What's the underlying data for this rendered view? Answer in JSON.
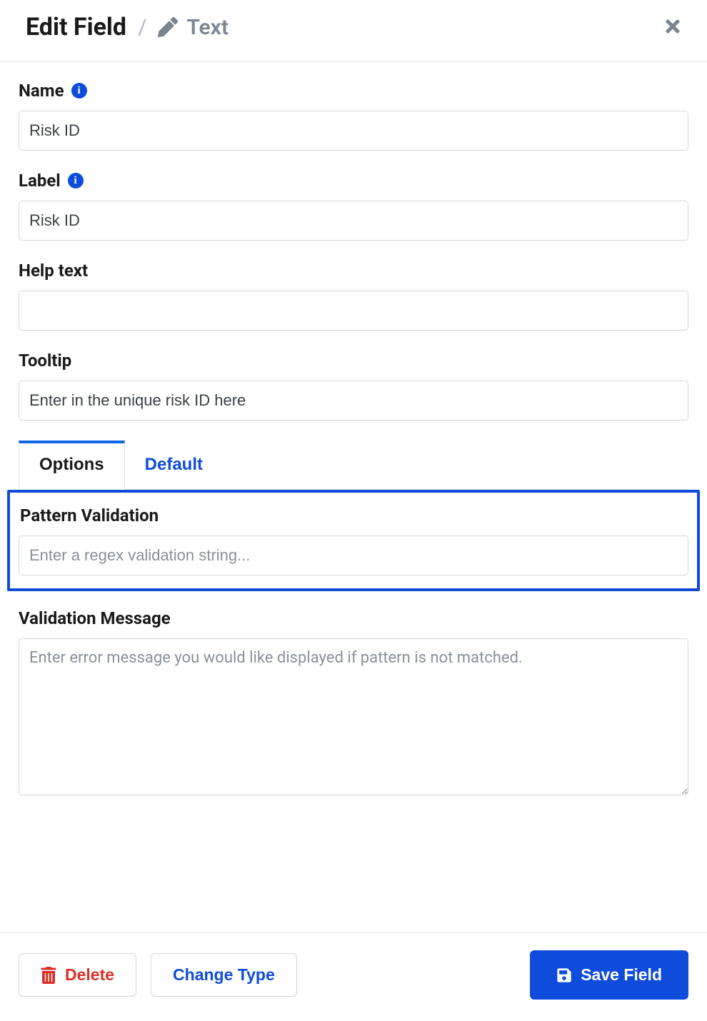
{
  "header": {
    "title": "Edit Field",
    "separator": "/",
    "type_label": "Text"
  },
  "form": {
    "name": {
      "label": "Name",
      "value": "Risk ID",
      "has_info": true
    },
    "labelField": {
      "label": "Label",
      "value": "Risk ID",
      "has_info": true
    },
    "helpText": {
      "label": "Help text",
      "value": ""
    },
    "tooltip": {
      "label": "Tooltip",
      "value": "Enter in the unique risk ID here"
    }
  },
  "tabs": {
    "options": "Options",
    "default": "Default",
    "active": "Options"
  },
  "options": {
    "patternValidation": {
      "label": "Pattern Validation",
      "placeholder": "Enter a regex validation string...",
      "value": ""
    },
    "validationMessage": {
      "label": "Validation Message",
      "placeholder": "Enter error message you would like displayed if pattern is not matched.",
      "value": ""
    }
  },
  "footer": {
    "delete": "Delete",
    "changeType": "Change Type",
    "saveField": "Save Field"
  }
}
